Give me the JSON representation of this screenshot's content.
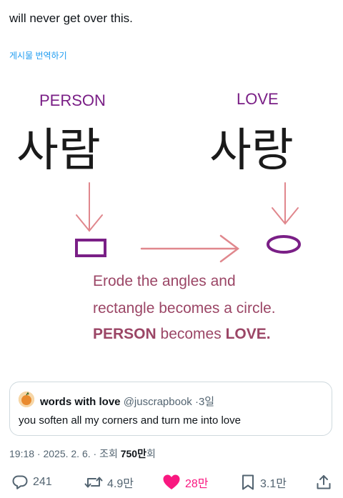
{
  "tweet": {
    "text": "will never get over this.",
    "translate_label": "게시물 번역하기"
  },
  "image": {
    "person_label": "PERSON",
    "love_label": "LOVE",
    "person_korean": "사람",
    "love_korean": "사랑",
    "caption_line1": "Erode the angles and",
    "caption_line2": "rectangle becomes a circle.",
    "caption_line3_a": "PERSON",
    "caption_line3_b": " becomes ",
    "caption_line3_c": "LOVE."
  },
  "quote": {
    "name": "words with love",
    "handle": "@juscrapbook",
    "dot": "·",
    "time": "3일",
    "text": "you soften all my corners and turn me into love"
  },
  "meta": {
    "time": "19:18 · 2025. 2. 6. · 조회 ",
    "views": "750만",
    "views_suffix": "회"
  },
  "actions": {
    "reply_count": "241",
    "retweet_count": "4.9만",
    "like_count": "28만",
    "bookmark_count": "3.1만"
  },
  "colors": {
    "link": "#1d9bf0",
    "like": "#f91880",
    "muted": "#536471",
    "purple": "#7a1f86",
    "arrow_pink": "#e0878d",
    "caption": "#9b4666"
  }
}
